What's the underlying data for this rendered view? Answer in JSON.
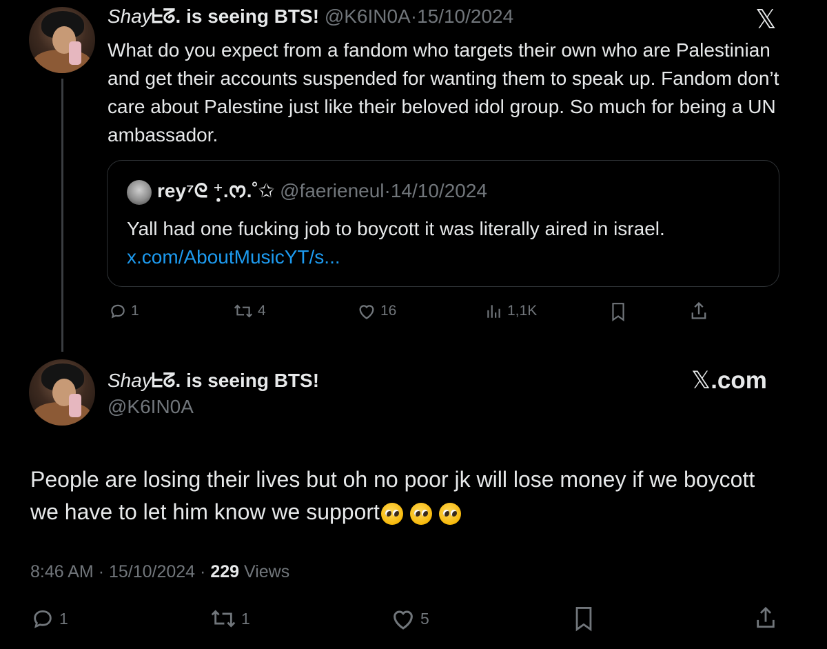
{
  "reply_tweet": {
    "display_name_script": "Shay",
    "display_name_glyph": "ᖶᘔ",
    "display_name_rest": ". is seeing BTS!",
    "handle": "@K6IN0A",
    "separator": "·",
    "date": "15/10/2024",
    "text": "What do you expect from a fandom who targets their own who are Palestinian and get their accounts suspended for wanting them to speak up. Fandom don’t care about Palestine just like their beloved idol group. So much for being a UN ambassador.",
    "quote": {
      "display_name": "rey⁷ᘓ ⁺̣̩̩.ᰔ.˚✩",
      "handle": "@faerieneul",
      "separator": "·",
      "date": "14/10/2024",
      "text": "Yall had one fucking job to boycott it was literally aired in israel.",
      "link": "x.com/AboutMusicYT/s..."
    },
    "actions": {
      "replies": "1",
      "reposts": "4",
      "likes": "16",
      "views": "1,1K"
    }
  },
  "main_tweet": {
    "display_name_script": "Shay",
    "display_name_glyph": "ᖶᘔ",
    "display_name_rest": ". is seeing BTS!",
    "handle": "@K6IN0A",
    "brand": "X",
    "brand_suffix": ".com",
    "text": "People are losing their lives but oh no poor jk will lose money if we boycott we have to let him know we support",
    "emojis": [
      "pleading-face",
      "pleading-face",
      "pleading-face"
    ],
    "time": "8:46 AM",
    "separator": "·",
    "date": "15/10/2024",
    "views_count": "229",
    "views_label": "Views",
    "actions": {
      "replies": "1",
      "reposts": "1",
      "likes": "5"
    }
  },
  "colors": {
    "background": "#000000",
    "text": "#e7e9ea",
    "muted": "#71767b",
    "link": "#1d9bf0",
    "border": "#2f3336"
  }
}
